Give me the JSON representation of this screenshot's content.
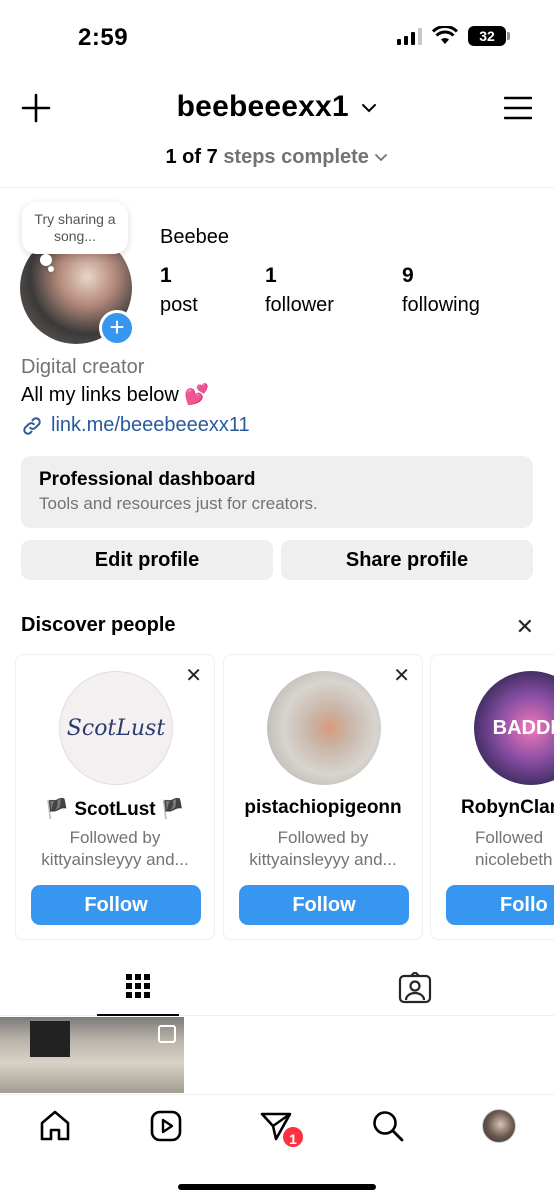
{
  "status_bar": {
    "time": "2:59",
    "battery": "32"
  },
  "header": {
    "username": "beebeeexx1",
    "steps_count": "1 of 7",
    "steps_label": "steps complete"
  },
  "profile": {
    "note": "Try sharing a song...",
    "display_name": "Beebee",
    "stats": [
      {
        "num": "1",
        "label": "post"
      },
      {
        "num": "1",
        "label": "follower"
      },
      {
        "num": "9",
        "label": "following"
      }
    ],
    "category": "Digital creator",
    "bio": "All my links below 💕",
    "link": "link.me/beeebeeexx11"
  },
  "dashboard": {
    "title": "Professional dashboard",
    "subtitle": "Tools and resources just for creators."
  },
  "actions": {
    "edit": "Edit profile",
    "share": "Share profile"
  },
  "discover": {
    "title": "Discover people",
    "cards": [
      {
        "name": "🏴 ScotLust 🏴",
        "pic_text": "ScotLust",
        "sub1": "Followed by",
        "sub2": "kittyainsleyyy and...",
        "follow": "Follow"
      },
      {
        "name": "pistachiopigeonn",
        "sub1": "Followed by",
        "sub2": "kittyainsleyyy and...",
        "follow": "Follow"
      },
      {
        "name": "RobynClar",
        "pic_text": "BADDIE",
        "sub1": "Followed",
        "sub2": "nicolebeth",
        "follow": "Follo"
      }
    ]
  },
  "nav": {
    "badge": "1"
  },
  "colors": {
    "accent": "#3797f0",
    "badge": "#ff3040",
    "link": "#2a5a9c"
  }
}
